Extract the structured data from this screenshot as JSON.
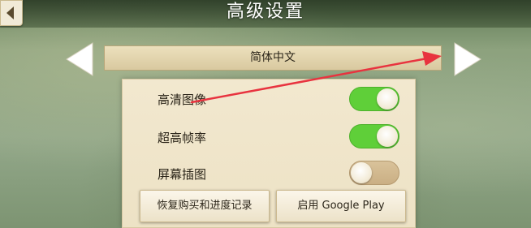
{
  "header": {
    "title": "高级设置"
  },
  "language_selector": {
    "current": "简体中文"
  },
  "settings": {
    "hd_graphics": {
      "label": "高清图像",
      "enabled": true
    },
    "high_fps": {
      "label": "超高帧率",
      "enabled": true
    },
    "screen_illustrations": {
      "label": "屏幕插图",
      "enabled": false
    }
  },
  "buttons": {
    "restore_label": "恢复购买和进度记录",
    "google_play_label": "启用 Google Play"
  },
  "colors": {
    "toggle_on": "#5fcf39",
    "toggle_off": "#caaf84",
    "annotation_arrow": "#e8333f"
  },
  "icons": {
    "back": "back-arrow-icon",
    "prev": "triangle-left-icon",
    "next": "triangle-right-icon"
  }
}
